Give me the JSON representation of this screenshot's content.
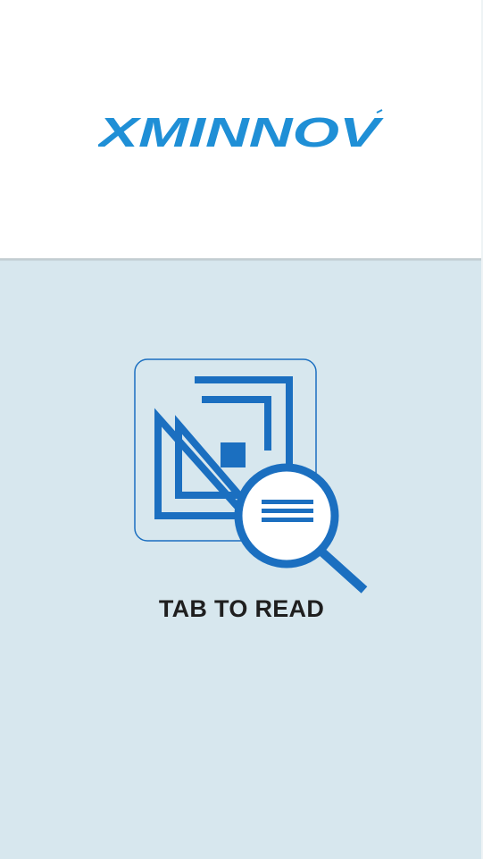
{
  "app": {
    "brand_name": "XMINNOV",
    "brand_color": "#1f8fd6",
    "background_color": "#d7e7ee"
  },
  "main": {
    "action_label": "TAB TO READ",
    "illustration_icon": "rfid-tag-magnifier-icon",
    "icon_color": "#1b6fc0"
  }
}
